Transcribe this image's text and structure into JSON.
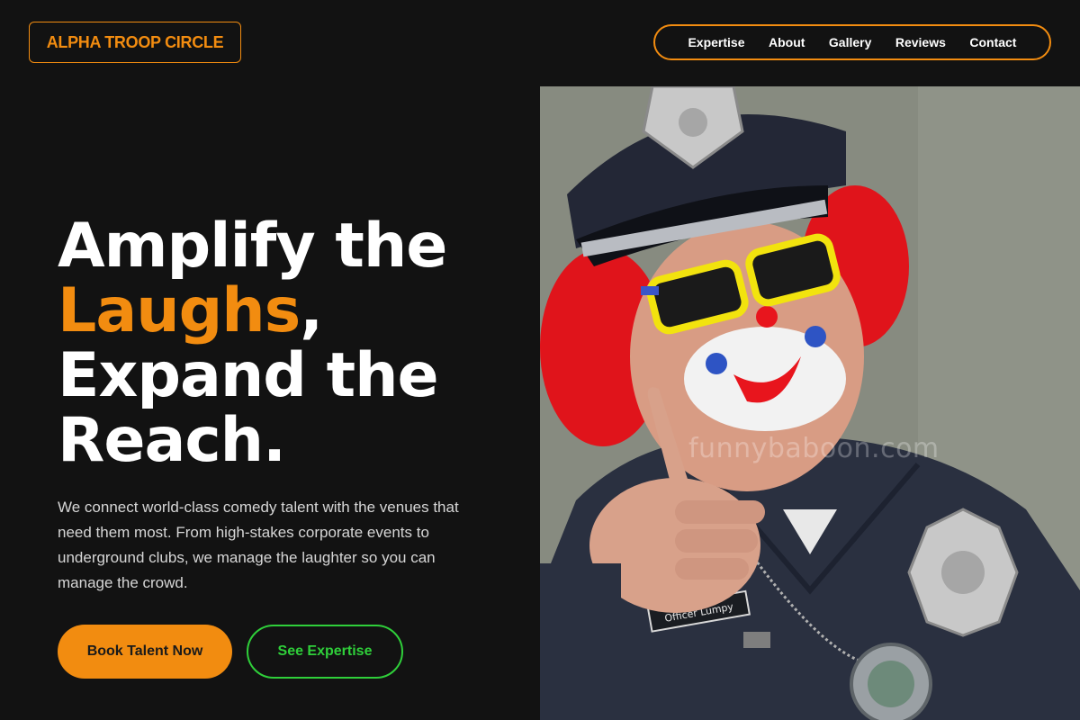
{
  "header": {
    "logo_text": "ALPHA TROOP CIRCLE",
    "nav": [
      {
        "label": "Expertise"
      },
      {
        "label": "About"
      },
      {
        "label": "Gallery"
      },
      {
        "label": "Reviews"
      },
      {
        "label": "Contact"
      }
    ]
  },
  "hero": {
    "title_line1": "Amplify the",
    "title_accent": "Laughs",
    "title_comma": ",",
    "title_line3": "Expand the",
    "title_line4": "Reach.",
    "description": "We connect world-class comedy talent with the venues that need them most. From high-stakes corporate events to underground clubs, we manage the laughter so you can manage the crowd.",
    "primary_button": "Book Talent Now",
    "secondary_button": "See Expertise",
    "image": {
      "watermark": "funnybaboon.com",
      "name_tag": "Officer Lumpy"
    }
  },
  "colors": {
    "background": "#121212",
    "accent_orange": "#f28c10",
    "accent_green": "#2fcf3a",
    "text": "#ffffff"
  },
  "icons": [
    "photo-clown-officer"
  ]
}
